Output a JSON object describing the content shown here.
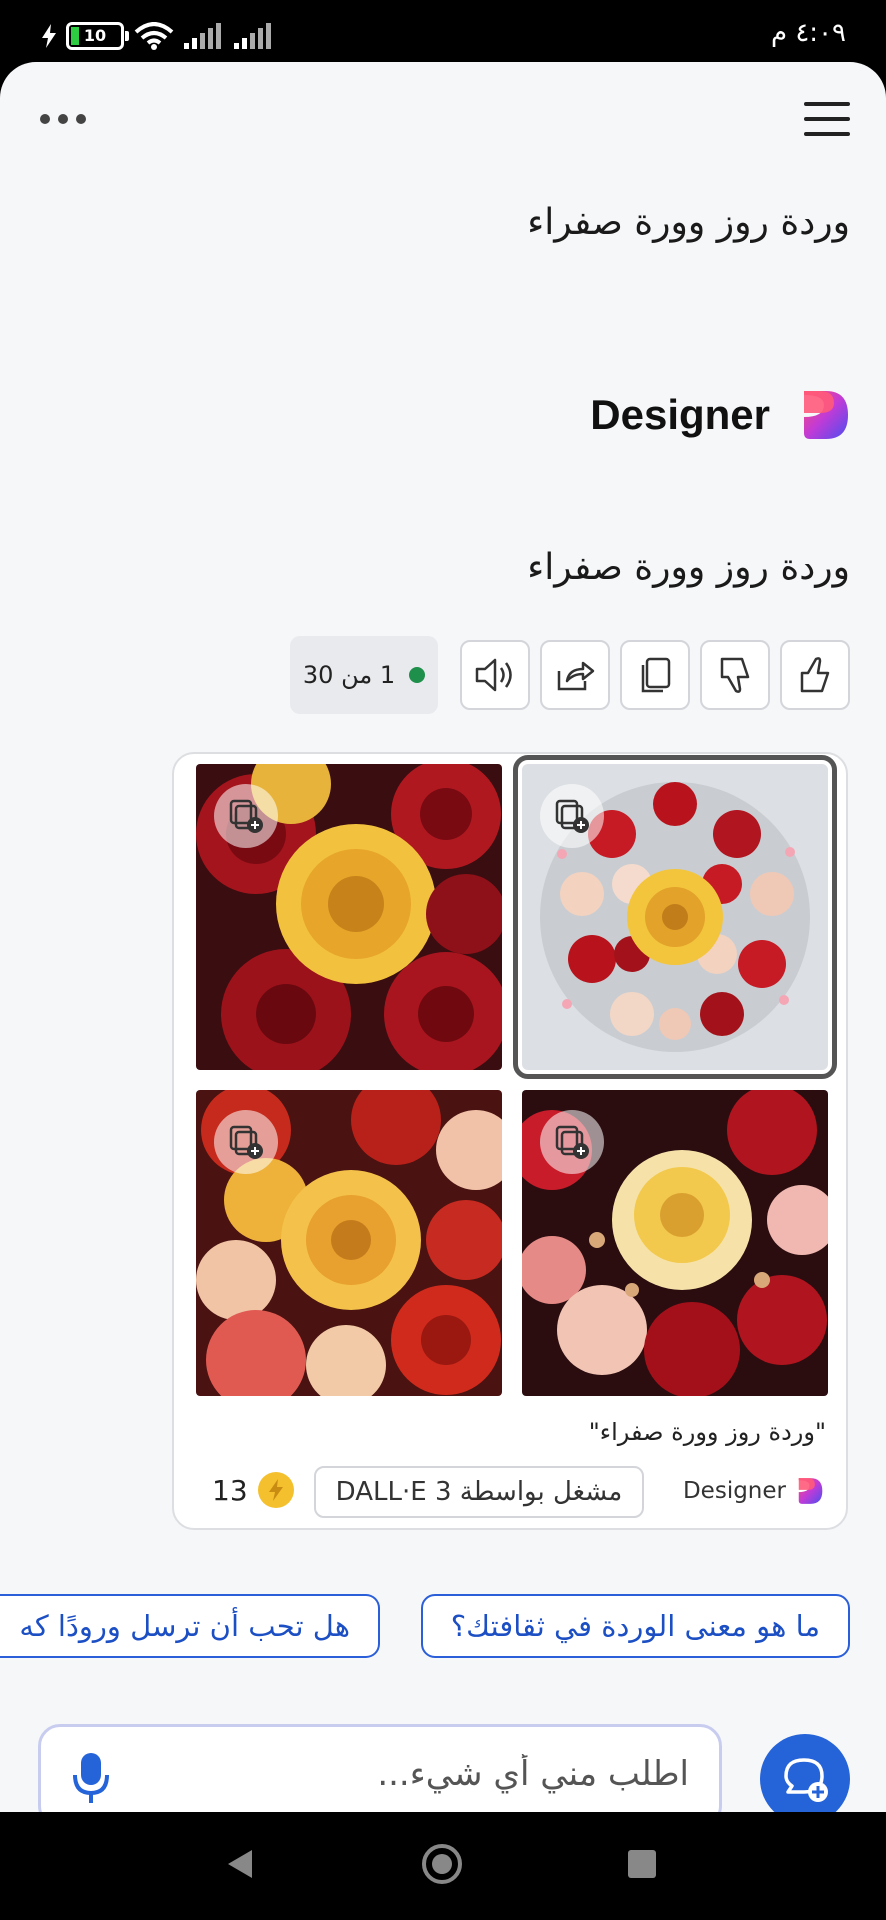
{
  "status_bar": {
    "time": "٤:٠٩ م",
    "battery_level": "10"
  },
  "conversation": {
    "user_message": "وردة روز وورة صفراء",
    "assistant_name": "Designer",
    "assistant_message": "وردة روز وورة صفراء",
    "counter_text": "1 من 30"
  },
  "image_card": {
    "caption": "\"وردة روز وورة صفراء\"",
    "brand": "Designer",
    "powered_by": "مشغل بواسطة DALL·E 3",
    "boosts": "13",
    "images": [
      {
        "alt": "Bouquet of yellow and red roses",
        "selected": false
      },
      {
        "alt": "Round arrangement of red, pink and yellow roses",
        "selected": true
      },
      {
        "alt": "Dense field of yellow, red and pink roses",
        "selected": false
      },
      {
        "alt": "White-yellow rose among red and pink roses",
        "selected": false
      }
    ]
  },
  "suggestions": [
    "ما هو معنى الوردة في ثقافتك؟",
    "هل تحب أن ترسل ورودًا كه"
  ],
  "composer": {
    "placeholder": "اطلب مني أي شيء..."
  },
  "colors": {
    "accent": "#2563d8",
    "counter_dot": "#1f8f4c",
    "boost": "#f4c02e"
  }
}
